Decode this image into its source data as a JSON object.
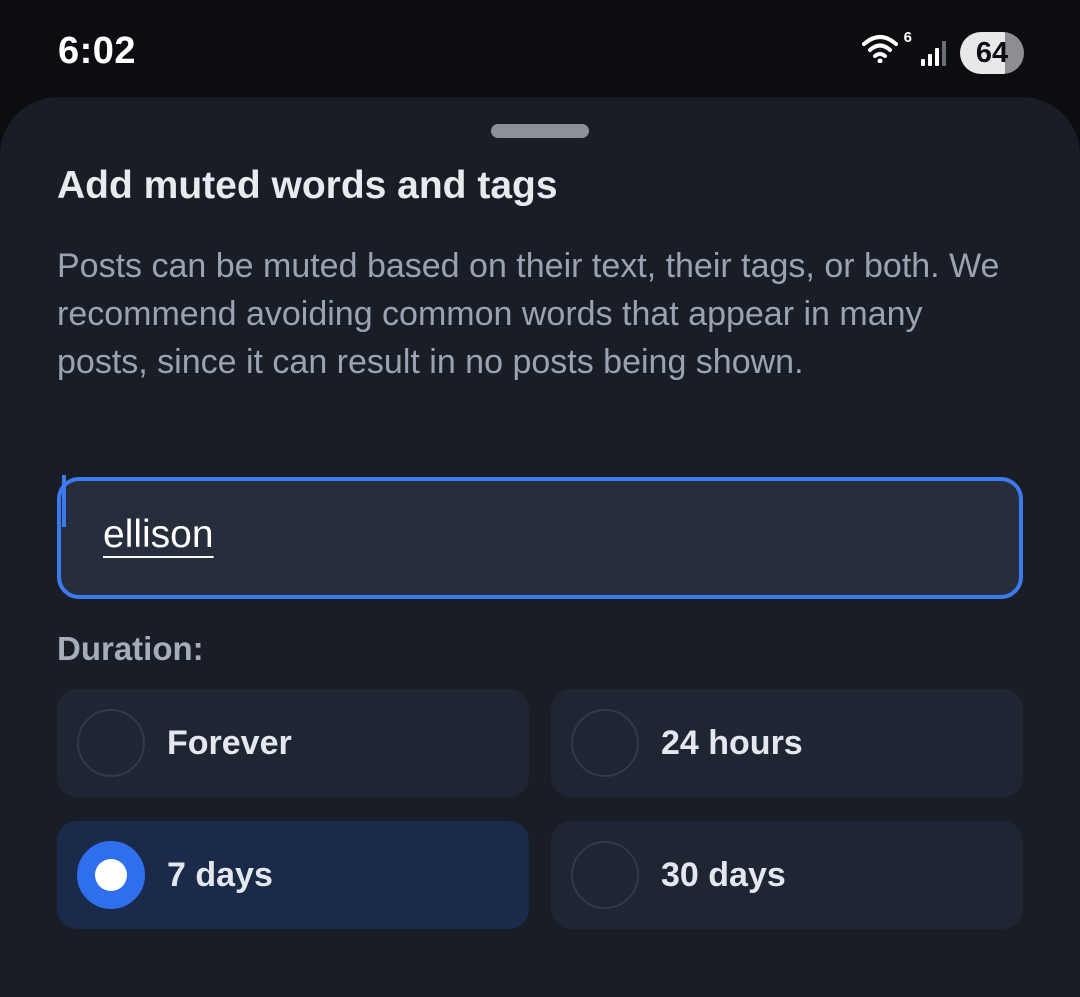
{
  "status_bar": {
    "time": "6:02",
    "wifi_label": "6",
    "battery": "64",
    "icons": [
      "wifi-icon",
      "signal-icon",
      "battery-icon"
    ]
  },
  "sheet": {
    "title": "Add muted words and tags",
    "description": "Posts can be muted based on their text, their tags, or both. We recommend avoiding common words that appear in many posts, since it can result in no posts being shown.",
    "input": {
      "value": "ellison"
    },
    "duration_label": "Duration:",
    "options": [
      {
        "label": "Forever",
        "selected": false
      },
      {
        "label": "24 hours",
        "selected": false
      },
      {
        "label": "7 days",
        "selected": true
      },
      {
        "label": "30 days",
        "selected": false
      }
    ]
  },
  "colors": {
    "background": "#0b0d11",
    "sheet": "#181d26",
    "accent": "#3b7bef",
    "selected_option": "#1a2a4a",
    "option": "#1e2533"
  }
}
